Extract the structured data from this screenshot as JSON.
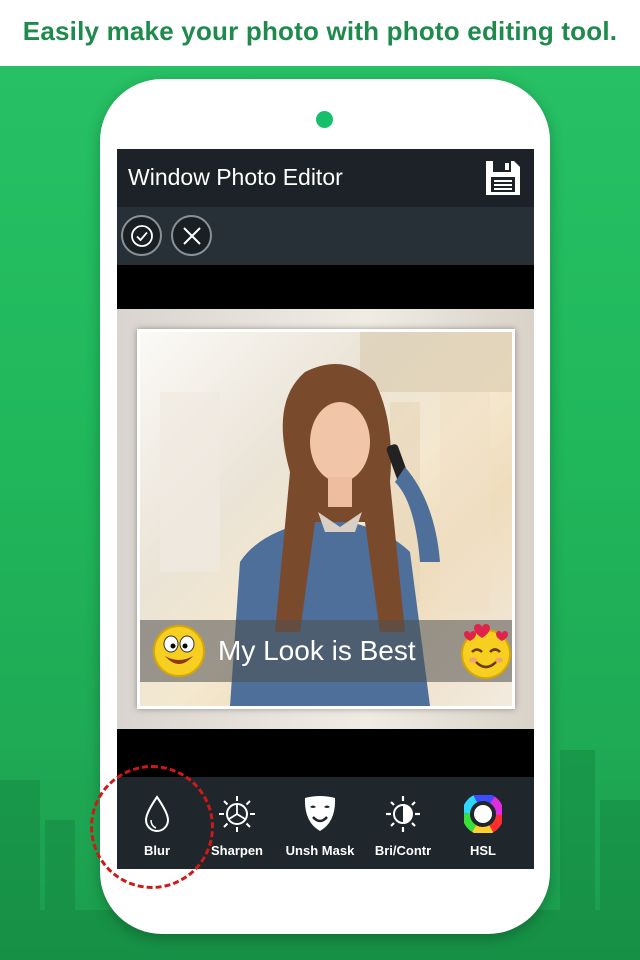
{
  "headline": "Easily make your photo with photo editing tool.",
  "app": {
    "title": "Window Photo Editor",
    "save_icon": "floppy-disk-icon",
    "confirm_icon": "check-circle-icon",
    "cancel_icon": "close-icon"
  },
  "caption": {
    "text": "My Look is Best",
    "left_emoji": "goofy-face-emoji",
    "right_emoji": "heart-crown-smile-emoji"
  },
  "tools": [
    {
      "label": "Blur",
      "icon": "water-drop-icon",
      "selected": true
    },
    {
      "label": "Sharpen",
      "icon": "sun-gear-icon"
    },
    {
      "label": "Unsh Mask",
      "icon": "mask-icon"
    },
    {
      "label": "Bri/Contr",
      "icon": "brightness-icon"
    },
    {
      "label": "HSL",
      "icon": "color-wheel-icon"
    }
  ],
  "colors": {
    "accent_green": "#22b85d",
    "headline_green": "#1e8a4c",
    "highlight_red": "#d01818",
    "toolbar_dark": "#1f272c"
  }
}
